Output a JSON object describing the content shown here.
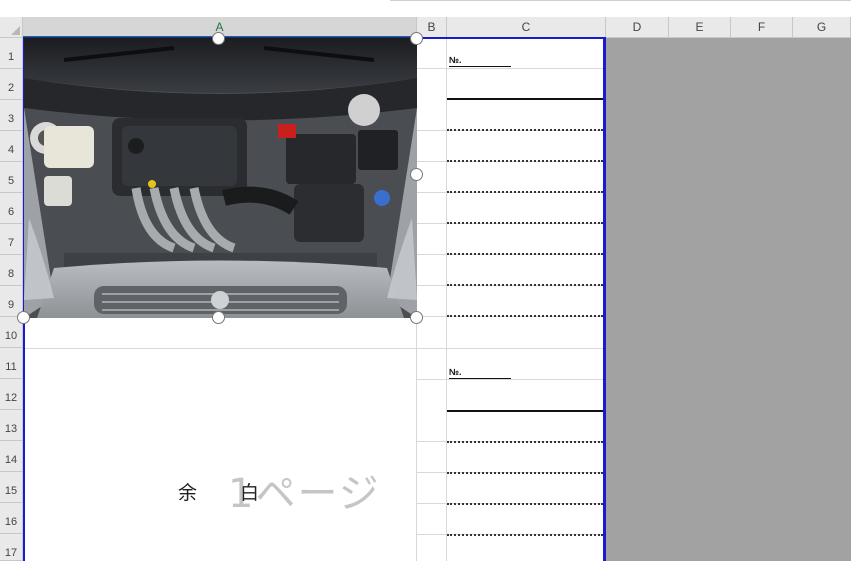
{
  "columns": [
    {
      "label": "A",
      "selected": true
    },
    {
      "label": "B",
      "selected": false
    },
    {
      "label": "C",
      "selected": false
    },
    {
      "label": "D",
      "selected": false
    },
    {
      "label": "E",
      "selected": false
    },
    {
      "label": "F",
      "selected": false
    },
    {
      "label": "G",
      "selected": false
    }
  ],
  "rows": [
    "1",
    "2",
    "3",
    "4",
    "5",
    "6",
    "7",
    "8",
    "9",
    "10",
    "11",
    "12",
    "13",
    "14",
    "15",
    "16",
    "17"
  ],
  "cells": {
    "no_label_1": "№.",
    "no_label_2": "№.",
    "yohaku_1": "余",
    "yohaku_2": "白"
  },
  "watermark": {
    "text": "1ページ"
  },
  "image": {
    "alt": "engine bay photo"
  },
  "colors": {
    "page_break": "#1a1ad4",
    "header_bg": "#e9e9e9",
    "outside_print_area": "#a2a2a2",
    "selected_header": "#217346"
  }
}
